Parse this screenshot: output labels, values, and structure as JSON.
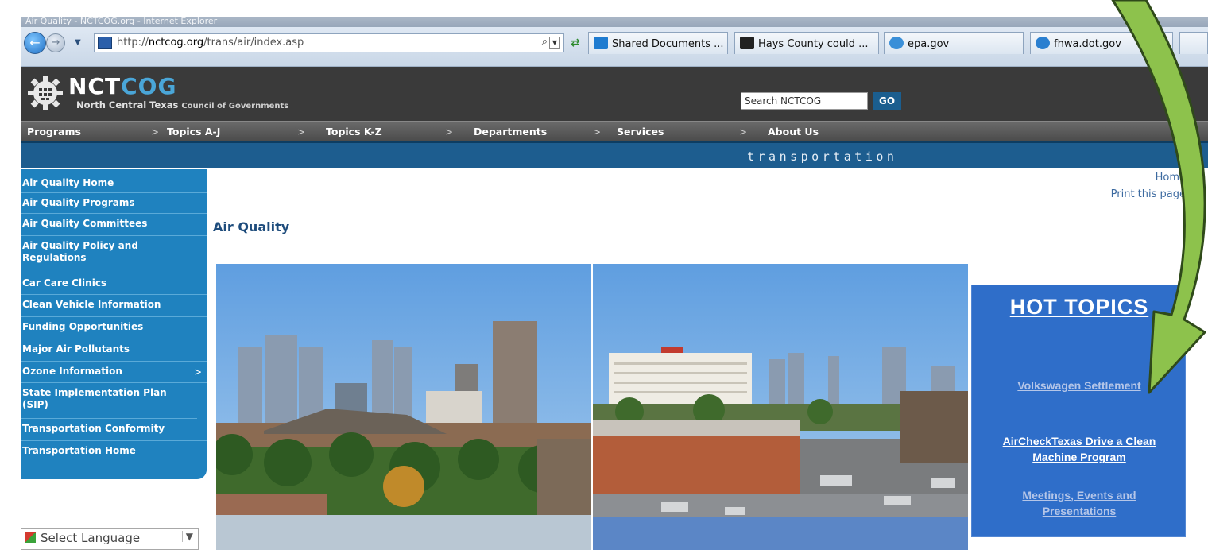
{
  "browser": {
    "window_title": "Air Quality - NCTCOG.org - Internet Explorer",
    "url_prefix": "http://",
    "url_domain": "nctcog.org",
    "url_path": "/trans/air/index.asp",
    "url_tools": "⌕",
    "tabs": [
      {
        "label": "Shared Documents ...",
        "icon_color": "#1e7bd0",
        "icon": "sharepoint-icon"
      },
      {
        "label": "Hays County could ...",
        "icon_color": "#222222",
        "icon": "site-s-icon"
      },
      {
        "label": "epa.gov",
        "icon_color": "#3a8fd8",
        "icon": "epa-icon"
      },
      {
        "label": "fhwa.dot.gov",
        "icon_color": "#2a7fd0",
        "icon": "fhwa-icon"
      }
    ]
  },
  "header": {
    "logo_part1": "NCT",
    "logo_part2": "COG",
    "logo_sub_main": "North Central Texas ",
    "logo_sub_rest": "Council of Governments",
    "search_value": "Search NCTCOG",
    "go_label": "GO"
  },
  "nav": {
    "items": [
      "Programs",
      "Topics A-J",
      "Topics K-Z",
      "Departments",
      "Services",
      "About Us"
    ],
    "separator": ">"
  },
  "banner": {
    "section": "transportation"
  },
  "sidebar": {
    "items": [
      {
        "label": "Air Quality Home"
      },
      {
        "label": "Air Quality Programs"
      },
      {
        "label": "Air Quality Committees"
      },
      {
        "label": "Air Quality Policy and Regulations"
      },
      {
        "label": "Car Care Clinics"
      },
      {
        "label": "Clean Vehicle Information"
      },
      {
        "label": "Funding Opportunities"
      },
      {
        "label": "Major Air Pollutants"
      },
      {
        "label": "Ozone Information",
        "chevron": ">"
      },
      {
        "label": "State Implementation Plan (SIP)"
      },
      {
        "label": "Transportation Conformity"
      },
      {
        "label": "Transportation Home"
      }
    ],
    "language": "Select Language",
    "language_dd": "▼"
  },
  "content": {
    "home_link": "Home",
    "print_link": "Print this page",
    "title": "Air Quality"
  },
  "hot_topics": {
    "title": "HOT TOPICS",
    "links": [
      {
        "label": "Volkswagen Settlement",
        "color": "#b5c6e8"
      },
      {
        "label": "AirCheckTexas Drive a Clean Machine Program",
        "color": "#ffffff"
      },
      {
        "label": "Meetings, Events and Presentations",
        "color": "#b5c6e8"
      }
    ]
  },
  "colors": {
    "nav_blue": "#1f82bf",
    "banner_blue": "#1d5d8f",
    "hot_topics_blue": "#2f6ec9",
    "arrow_green": "#8dc24c"
  }
}
